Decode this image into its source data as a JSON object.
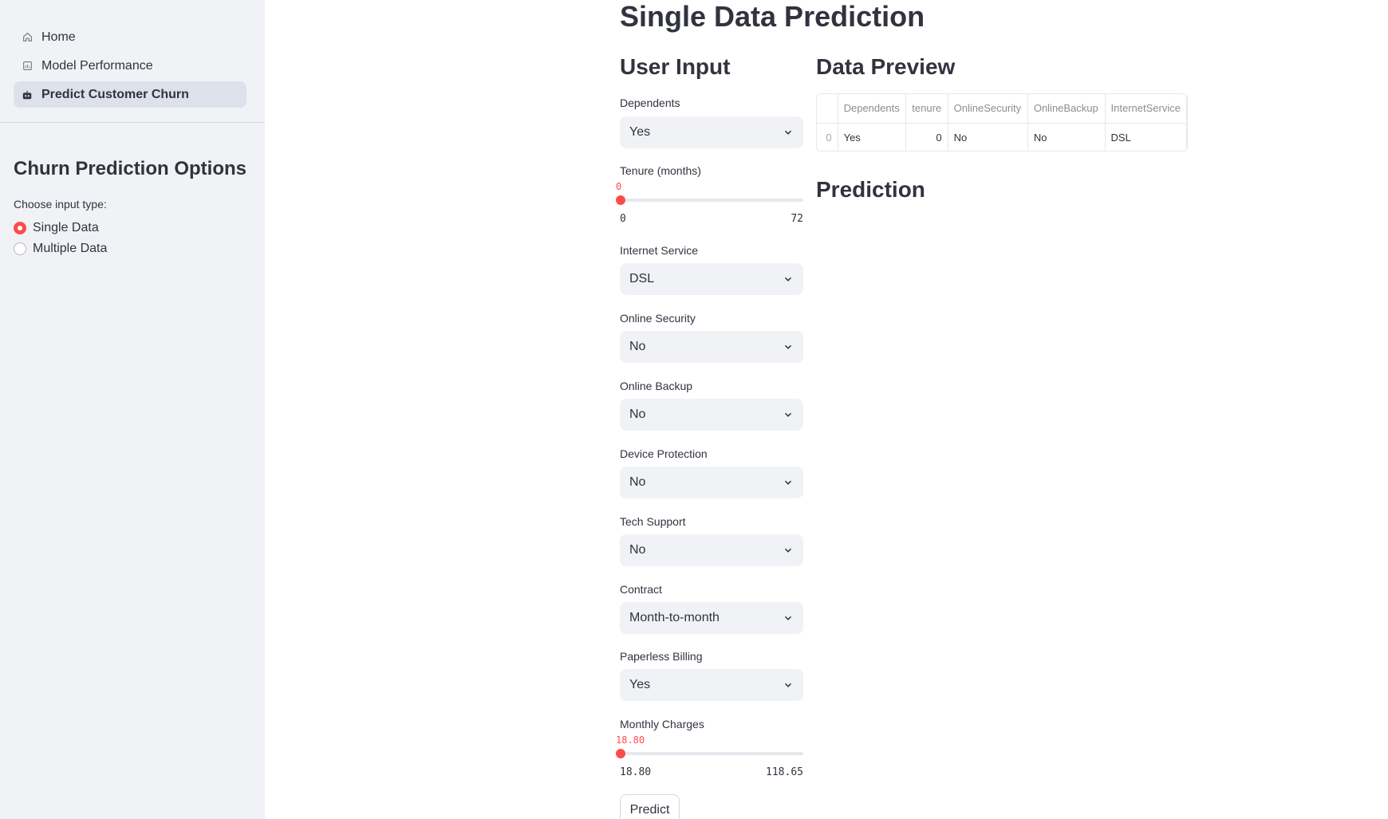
{
  "sidebar": {
    "nav": [
      {
        "label": "Home",
        "icon": "home-icon"
      },
      {
        "label": "Model Performance",
        "icon": "chart-icon"
      },
      {
        "label": "Predict Customer Churn",
        "icon": "robot-icon",
        "active": true
      }
    ],
    "options_title": "Churn Prediction Options",
    "input_type_label": "Choose input type:",
    "input_types": [
      {
        "label": "Single Data",
        "checked": true
      },
      {
        "label": "Multiple Data",
        "checked": false
      }
    ]
  },
  "main": {
    "title": "Single Data Prediction",
    "user_input_title": "User Input",
    "data_preview_title": "Data Preview",
    "prediction_title": "Prediction",
    "fields": {
      "dependents": {
        "label": "Dependents",
        "value": "Yes"
      },
      "tenure": {
        "label": "Tenure (months)",
        "value": "0",
        "min": "0",
        "max": "72",
        "fraction": 0
      },
      "internet_service": {
        "label": "Internet Service",
        "value": "DSL"
      },
      "online_security": {
        "label": "Online Security",
        "value": "No"
      },
      "online_backup": {
        "label": "Online Backup",
        "value": "No"
      },
      "device_protection": {
        "label": "Device Protection",
        "value": "No"
      },
      "tech_support": {
        "label": "Tech Support",
        "value": "No"
      },
      "contract": {
        "label": "Contract",
        "value": "Month-to-month"
      },
      "paperless_billing": {
        "label": "Paperless Billing",
        "value": "Yes"
      },
      "monthly_charges": {
        "label": "Monthly Charges",
        "value": "18.80",
        "min": "18.80",
        "max": "118.65",
        "fraction": 0
      }
    },
    "predict_button": "Predict",
    "preview_table": {
      "headers": [
        "",
        "Dependents",
        "tenure",
        "OnlineSecurity",
        "OnlineBackup",
        "InternetService"
      ],
      "rows": [
        [
          "0",
          "Yes",
          "0",
          "No",
          "No",
          "DSL"
        ]
      ]
    }
  },
  "colors": {
    "accent": "#ff4b4b",
    "sidebar_bg": "#f0f2f6",
    "text": "#31333f"
  }
}
